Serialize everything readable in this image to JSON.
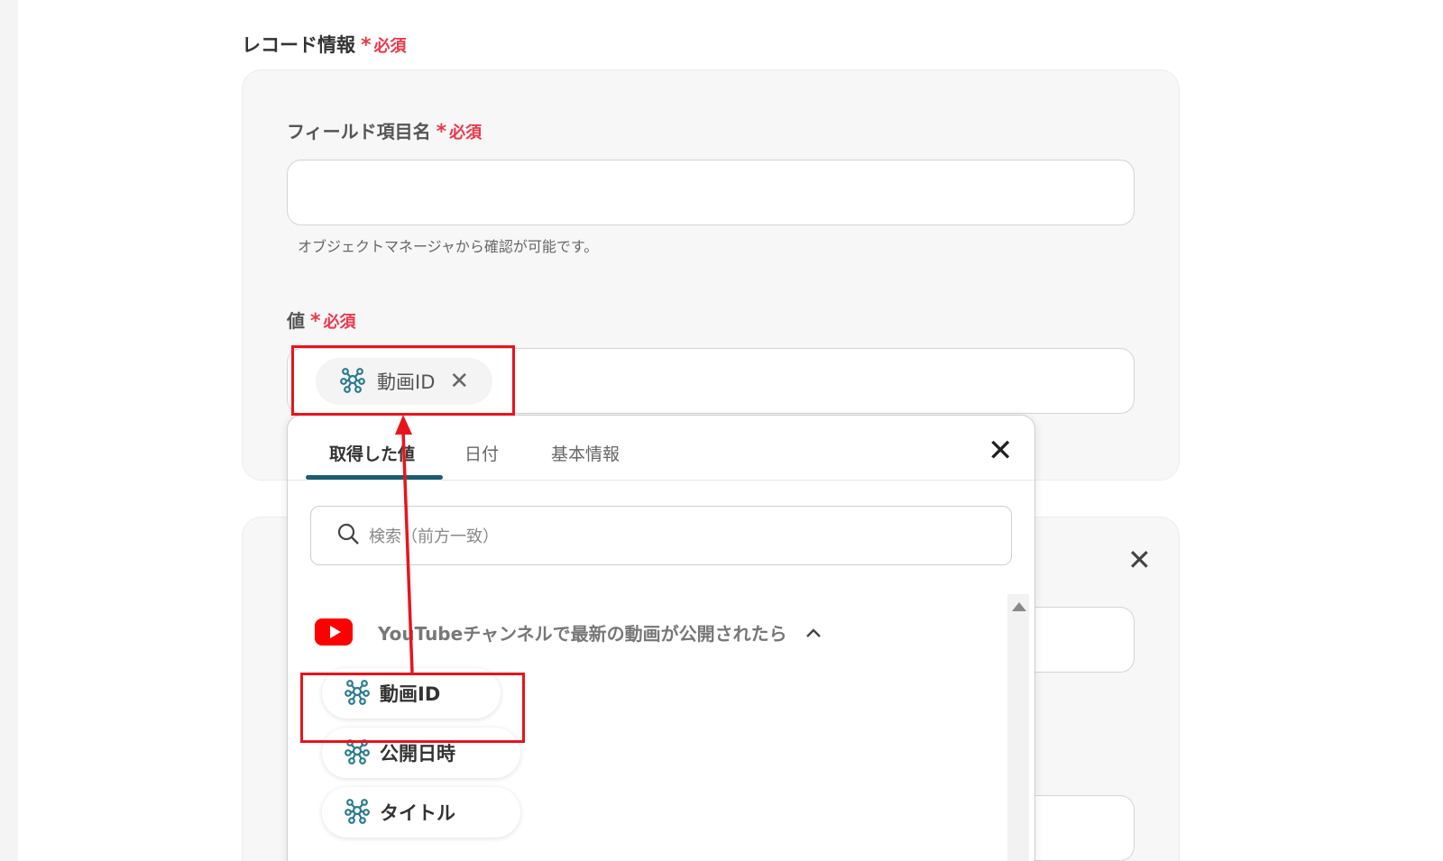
{
  "section": {
    "title": "レコード情報",
    "required_star": "*",
    "required_label": "必須"
  },
  "field_name": {
    "label": "フィールド項目名",
    "required_star": "*",
    "required_label": "必須",
    "value": "",
    "hint": "オブジェクトマネージャから確認が可能です。"
  },
  "value_field": {
    "label": "値",
    "required_star": "*",
    "required_label": "必須",
    "chip_label": "動画ID",
    "chip_remove": "✕"
  },
  "dropdown": {
    "tabs": [
      {
        "label": "取得した値",
        "active": true
      },
      {
        "label": "日付",
        "active": false
      },
      {
        "label": "基本情報",
        "active": false
      }
    ],
    "close": "✕",
    "search_placeholder": "検索（前方一致）",
    "group": {
      "label": "YouTubeチャンネルで最新の動画が公開されたら",
      "chevron": "^",
      "icon": "youtube-logo"
    },
    "items": [
      {
        "label": "動画ID",
        "icon": "network-icon"
      },
      {
        "label": "公開日時",
        "icon": "network-icon"
      },
      {
        "label": "タイトル",
        "icon": "network-icon"
      }
    ]
  },
  "second_card": {
    "close": "✕"
  },
  "colors": {
    "required": "#e8394c",
    "highlight": "#e8141c",
    "tab_underline": "#1c5c70",
    "icon": "#2a7a8c"
  }
}
